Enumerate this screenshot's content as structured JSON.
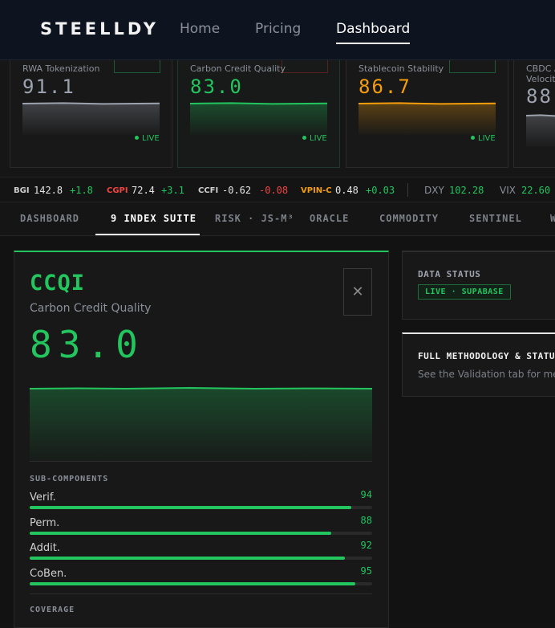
{
  "nav": {
    "logo": "STEELLDY",
    "links": [
      "Home",
      "Pricing",
      "Dashboard"
    ],
    "active": "Dashboard"
  },
  "cards": [
    {
      "title": "RWA Tokenization",
      "value": "91.1",
      "live": "LIVE",
      "color": "#9ca3af",
      "pill_color": "#1f5a36"
    },
    {
      "title": "Carbon Credit Quality",
      "value": "83.0",
      "live": "LIVE",
      "color": "#22c55e",
      "pill_color": "#5a1f1f"
    },
    {
      "title": "Stablecoin Stability",
      "value": "86.7",
      "live": "LIVE",
      "color": "#f59e0b",
      "pill_color": "#1f5a36"
    },
    {
      "title": "CBDC A",
      "title2": "Velocit",
      "value": "88",
      "color": "#9ca3af"
    }
  ],
  "ticker": [
    {
      "label": "BGI",
      "value": "142.8",
      "change": "+1.8",
      "label_color": "#cfcfcf",
      "change_color": "#22c55e"
    },
    {
      "label": "CGPI",
      "value": "72.4",
      "change": "+3.1",
      "label_color": "#ef4444",
      "change_color": "#22c55e"
    },
    {
      "label": "CCFI",
      "value": "-0.62",
      "change": "-0.08",
      "label_color": "#cfcfcf",
      "change_color": "#ef4444"
    },
    {
      "label": "VPIN-C",
      "value": "0.48",
      "change": "+0.03",
      "label_color": "#f59e0b",
      "change_color": "#22c55e"
    }
  ],
  "macro": [
    {
      "label": "DXY",
      "value": "102.28"
    },
    {
      "label": "VIX",
      "value": "22.60"
    }
  ],
  "tabs": [
    "DASHBOARD",
    "9 INDEX SUITE",
    "RISK · JS-M³",
    "ORACLE",
    "COMMODITY",
    "SENTINEL",
    "W"
  ],
  "active_tab": "9 INDEX SUITE",
  "detail": {
    "code": "CCQI",
    "name": "Carbon Credit Quality",
    "value": "83.0",
    "close_icon": "close-icon",
    "subcomponents_title": "SUB-COMPONENTS",
    "subcomponents": [
      {
        "label": "Verif.",
        "value": "94",
        "pct": 0.94
      },
      {
        "label": "Perm.",
        "value": "88",
        "pct": 0.88
      },
      {
        "label": "Addit.",
        "value": "92",
        "pct": 0.92
      },
      {
        "label": "CoBen.",
        "value": "95",
        "pct": 0.95
      }
    ],
    "coverage_title": "COVERAGE"
  },
  "data_status": {
    "title": "DATA STATUS",
    "badge": "LIVE · SUPABASE"
  },
  "methodology": {
    "title": "FULL METHODOLOGY & STATUS",
    "text": "See the Validation tab for me"
  },
  "accent": "#22c55e"
}
